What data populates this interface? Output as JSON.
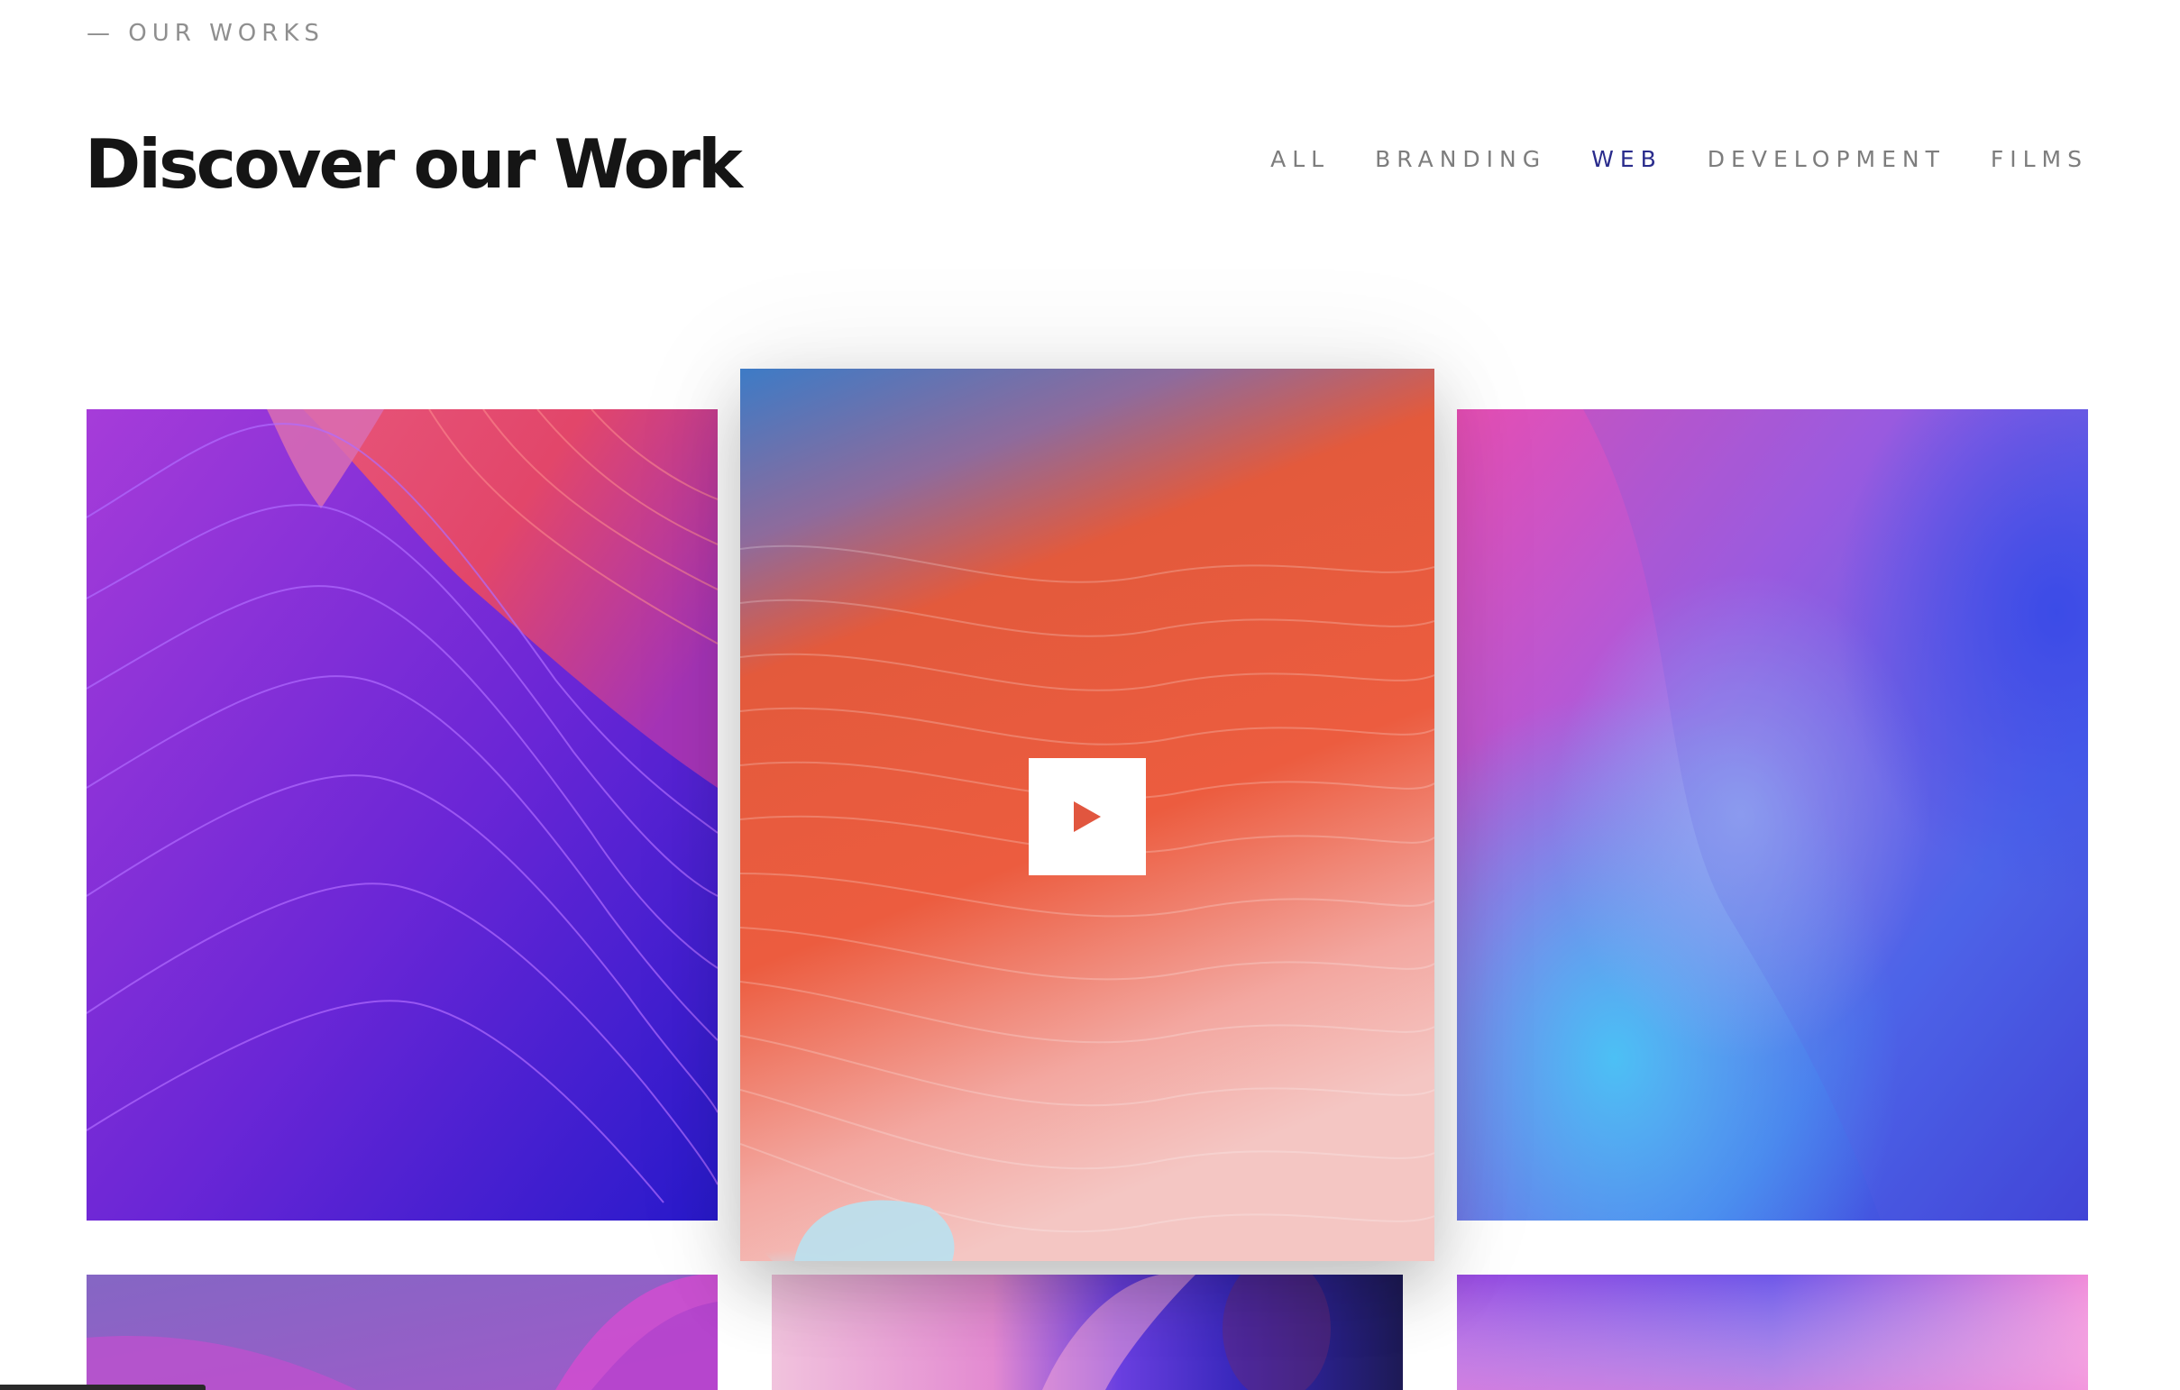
{
  "section": {
    "eyebrow": "— OUR WORKS",
    "title": "Discover our Work"
  },
  "filters": [
    {
      "label": "ALL",
      "active": false
    },
    {
      "label": "BRANDING",
      "active": false
    },
    {
      "label": "WEB",
      "active": true
    },
    {
      "label": "DEVELOPMENT",
      "active": false
    },
    {
      "label": "FILMS",
      "active": false
    }
  ],
  "colors": {
    "active_filter": "#2a2c8c",
    "inactive_filter": "#7d7d7d",
    "title": "#151515",
    "play_icon": "#e1563f"
  },
  "portfolio": {
    "items": [
      {
        "name": "purple-waves-card",
        "icon": ""
      },
      {
        "name": "orange-dunes-card",
        "icon": "play-icon"
      },
      {
        "name": "blue-gradient-card",
        "icon": ""
      },
      {
        "name": "violet-hills-card",
        "icon": ""
      },
      {
        "name": "pink-blur-card",
        "icon": ""
      },
      {
        "name": "magenta-haze-card",
        "icon": ""
      }
    ]
  }
}
